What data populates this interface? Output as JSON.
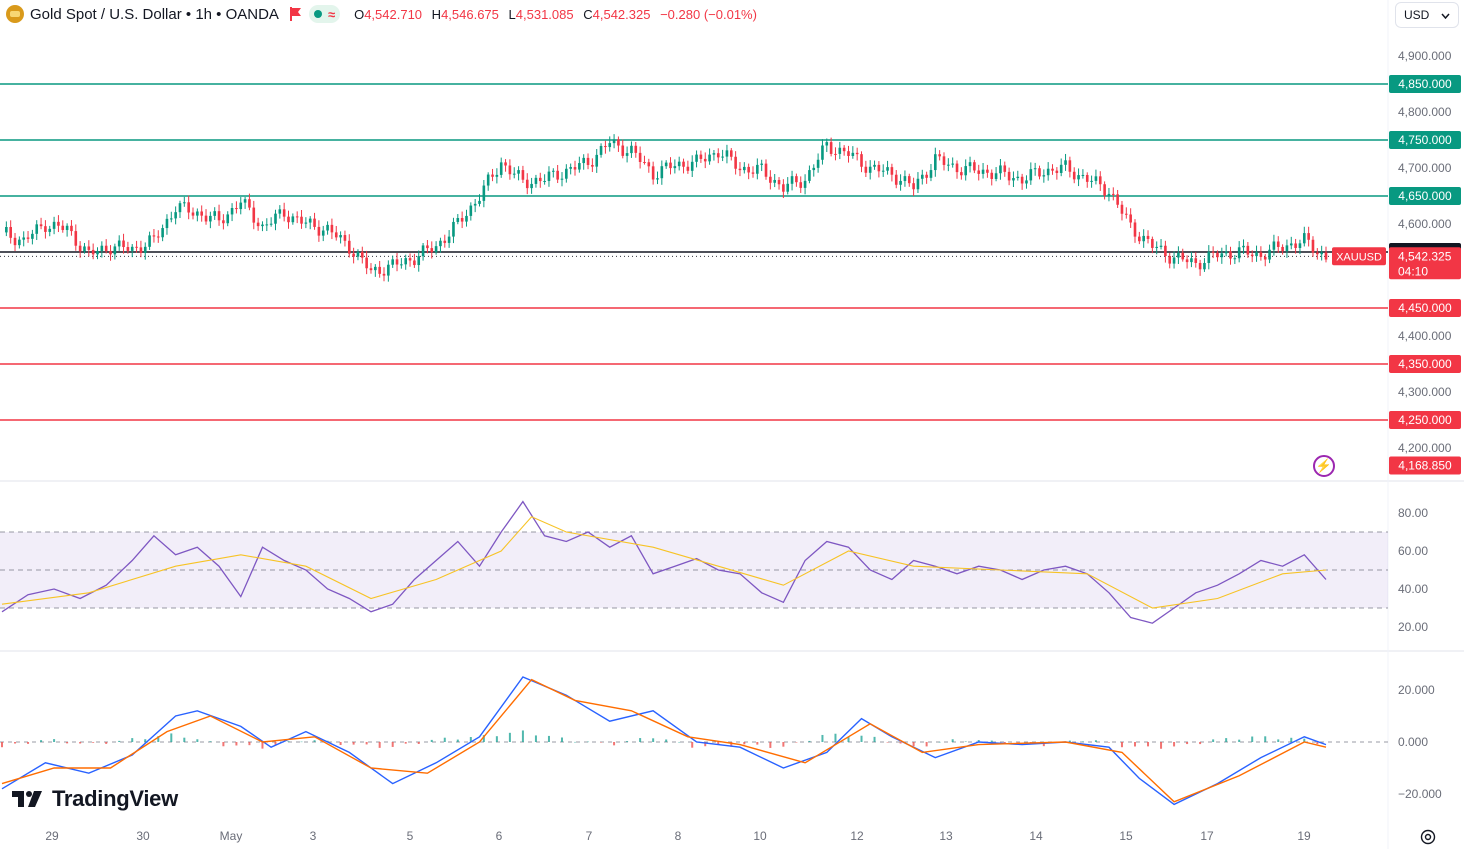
{
  "header": {
    "symbol_title": "Gold Spot / U.S. Dollar • 1h • OANDA",
    "open_label": "O",
    "open": "4,542.710",
    "high_label": "H",
    "high": "4,546.675",
    "low_label": "L",
    "low": "4,531.085",
    "close_label": "C",
    "close": "4,542.325",
    "change": "−0.280 (−0.01%)"
  },
  "currency_select": {
    "value": "USD"
  },
  "branding": {
    "name": "TradingView"
  },
  "icons": {
    "logo": "gold-coin-icon",
    "flag": "flag-icon",
    "market": "market-status-icon",
    "bolt": "lightning-icon",
    "settings": "settings-icon",
    "dropdown": "chevron-down-icon"
  },
  "colors": {
    "up": "#089981",
    "down": "#f23645",
    "support": "#f23645",
    "resistance": "#089981",
    "rsi": "#7e57c2",
    "rsi_ma": "#f7c325",
    "macd": "#2962ff",
    "signal": "#ff6d00"
  },
  "chart_data": [
    {
      "type": "candlestick",
      "title": "Gold Spot / U.S. Dollar • 1h • OANDA",
      "price_axis_ticks": [
        "4,900.000",
        "4,800.000",
        "4,700.000",
        "4,600.000",
        "4,400.000",
        "4,300.000",
        "4,200.000"
      ],
      "ylim": [
        4165,
        4930
      ],
      "time_axis_ticks": [
        "29",
        "30",
        "May",
        "3",
        "5",
        "6",
        "7",
        "8",
        "10",
        "12",
        "13",
        "14",
        "15",
        "17",
        "19"
      ],
      "horizontal_levels": [
        {
          "value": 4850,
          "label": "4,850.000",
          "kind": "resistance"
        },
        {
          "value": 4750,
          "label": "4,750.000",
          "kind": "resistance"
        },
        {
          "value": 4650,
          "label": "4,650.000",
          "kind": "resistance"
        },
        {
          "value": 4550,
          "label": "4,550.000",
          "kind": "pivot"
        },
        {
          "value": 4450,
          "label": "4,450.000",
          "kind": "support"
        },
        {
          "value": 4350,
          "label": "4,350.000",
          "kind": "support"
        },
        {
          "value": 4250,
          "label": "4,250.000",
          "kind": "support"
        }
      ],
      "last_price": {
        "symbol": "XAUUSD",
        "value": "4,542.325",
        "countdown": "04:10"
      },
      "low_marker": "4,168.850",
      "close_path": [
        [
          0,
          4585
        ],
        [
          5,
          4570
        ],
        [
          10,
          4600
        ],
        [
          15,
          4590
        ],
        [
          20,
          4545
        ],
        [
          25,
          4560
        ],
        [
          30,
          4555
        ],
        [
          35,
          4570
        ],
        [
          40,
          4630
        ],
        [
          45,
          4620
        ],
        [
          50,
          4605
        ],
        [
          55,
          4640
        ],
        [
          60,
          4595
        ],
        [
          65,
          4620
        ],
        [
          70,
          4600
        ],
        [
          75,
          4590
        ],
        [
          80,
          4560
        ],
        [
          85,
          4515
        ],
        [
          90,
          4525
        ],
        [
          95,
          4540
        ],
        [
          100,
          4560
        ],
        [
          105,
          4600
        ],
        [
          110,
          4650
        ],
        [
          115,
          4710
        ],
        [
          120,
          4675
        ],
        [
          125,
          4680
        ],
        [
          130,
          4695
        ],
        [
          135,
          4710
        ],
        [
          140,
          4745
        ],
        [
          145,
          4730
        ],
        [
          150,
          4690
        ],
        [
          155,
          4705
        ],
        [
          160,
          4710
        ],
        [
          165,
          4730
        ],
        [
          170,
          4700
        ],
        [
          175,
          4695
        ],
        [
          180,
          4665
        ],
        [
          185,
          4680
        ],
        [
          190,
          4740
        ],
        [
          195,
          4725
        ],
        [
          200,
          4700
        ],
        [
          205,
          4690
        ],
        [
          210,
          4665
        ],
        [
          215,
          4715
        ],
        [
          220,
          4700
        ],
        [
          225,
          4695
        ],
        [
          230,
          4690
        ],
        [
          235,
          4680
        ],
        [
          240,
          4695
        ],
        [
          245,
          4700
        ],
        [
          250,
          4680
        ],
        [
          255,
          4660
        ],
        [
          260,
          4595
        ],
        [
          265,
          4560
        ],
        [
          270,
          4540
        ],
        [
          275,
          4530
        ],
        [
          280,
          4545
        ],
        [
          285,
          4550
        ],
        [
          290,
          4545
        ],
        [
          295,
          4560
        ],
        [
          300,
          4570
        ],
        [
          305,
          4540
        ]
      ]
    },
    {
      "type": "line",
      "title": "RSI",
      "axis_ticks": [
        "80.00",
        "60.00",
        "40.00",
        "20.00"
      ],
      "ylim": [
        15,
        88
      ],
      "band": [
        30,
        70
      ],
      "midline": 50,
      "series": [
        {
          "role": "rsi",
          "points": [
            [
              0,
              28
            ],
            [
              6,
              37
            ],
            [
              12,
              40
            ],
            [
              18,
              35
            ],
            [
              24,
              42
            ],
            [
              30,
              55
            ],
            [
              35,
              68
            ],
            [
              40,
              58
            ],
            [
              45,
              62
            ],
            [
              50,
              52
            ],
            [
              55,
              36
            ],
            [
              60,
              62
            ],
            [
              65,
              55
            ],
            [
              70,
              50
            ],
            [
              75,
              40
            ],
            [
              80,
              35
            ],
            [
              85,
              28
            ],
            [
              90,
              32
            ],
            [
              95,
              45
            ],
            [
              100,
              55
            ],
            [
              105,
              65
            ],
            [
              110,
              52
            ],
            [
              115,
              70
            ],
            [
              120,
              86
            ],
            [
              125,
              68
            ],
            [
              130,
              65
            ],
            [
              135,
              70
            ],
            [
              140,
              62
            ],
            [
              145,
              68
            ],
            [
              150,
              48
            ],
            [
              155,
              52
            ],
            [
              160,
              56
            ],
            [
              165,
              50
            ],
            [
              170,
              48
            ],
            [
              175,
              38
            ],
            [
              180,
              33
            ],
            [
              185,
              55
            ],
            [
              190,
              65
            ],
            [
              195,
              62
            ],
            [
              200,
              50
            ],
            [
              205,
              45
            ],
            [
              210,
              55
            ],
            [
              215,
              52
            ],
            [
              220,
              48
            ],
            [
              225,
              52
            ],
            [
              230,
              50
            ],
            [
              235,
              45
            ],
            [
              240,
              50
            ],
            [
              245,
              52
            ],
            [
              250,
              48
            ],
            [
              255,
              38
            ],
            [
              260,
              25
            ],
            [
              265,
              22
            ],
            [
              270,
              30
            ],
            [
              275,
              38
            ],
            [
              280,
              42
            ],
            [
              285,
              48
            ],
            [
              290,
              55
            ],
            [
              295,
              52
            ],
            [
              300,
              58
            ],
            [
              305,
              45
            ]
          ]
        },
        {
          "role": "rsi-ma",
          "points": [
            [
              0,
              32
            ],
            [
              20,
              38
            ],
            [
              40,
              52
            ],
            [
              55,
              58
            ],
            [
              70,
              52
            ],
            [
              85,
              35
            ],
            [
              100,
              45
            ],
            [
              115,
              60
            ],
            [
              122,
              78
            ],
            [
              130,
              70
            ],
            [
              150,
              62
            ],
            [
              165,
              52
            ],
            [
              180,
              42
            ],
            [
              195,
              60
            ],
            [
              210,
              52
            ],
            [
              230,
              50
            ],
            [
              250,
              48
            ],
            [
              265,
              30
            ],
            [
              280,
              35
            ],
            [
              295,
              48
            ],
            [
              305,
              50
            ]
          ]
        }
      ]
    },
    {
      "type": "line",
      "title": "MACD",
      "axis_ticks": [
        "20.000",
        "0.000",
        "−20.000"
      ],
      "ylim": [
        -26,
        27
      ],
      "zero": 0,
      "series": [
        {
          "role": "macd",
          "points": [
            [
              0,
              -18
            ],
            [
              10,
              -8
            ],
            [
              20,
              -12
            ],
            [
              30,
              -5
            ],
            [
              40,
              10
            ],
            [
              45,
              12
            ],
            [
              55,
              6
            ],
            [
              62,
              -2
            ],
            [
              70,
              4
            ],
            [
              80,
              -4
            ],
            [
              90,
              -16
            ],
            [
              100,
              -8
            ],
            [
              110,
              2
            ],
            [
              120,
              25
            ],
            [
              130,
              18
            ],
            [
              140,
              8
            ],
            [
              150,
              12
            ],
            [
              160,
              0
            ],
            [
              170,
              -2
            ],
            [
              180,
              -10
            ],
            [
              190,
              -4
            ],
            [
              198,
              9
            ],
            [
              205,
              2
            ],
            [
              215,
              -6
            ],
            [
              225,
              0
            ],
            [
              235,
              -1
            ],
            [
              245,
              0
            ],
            [
              255,
              -2
            ],
            [
              262,
              -14
            ],
            [
              270,
              -24
            ],
            [
              280,
              -16
            ],
            [
              290,
              -6
            ],
            [
              300,
              2
            ],
            [
              305,
              -1
            ]
          ]
        },
        {
          "role": "signal",
          "points": [
            [
              0,
              -16
            ],
            [
              12,
              -10
            ],
            [
              25,
              -10
            ],
            [
              38,
              4
            ],
            [
              48,
              10
            ],
            [
              60,
              0
            ],
            [
              72,
              2
            ],
            [
              85,
              -10
            ],
            [
              98,
              -12
            ],
            [
              110,
              0
            ],
            [
              122,
              24
            ],
            [
              132,
              16
            ],
            [
              145,
              12
            ],
            [
              158,
              2
            ],
            [
              170,
              -1
            ],
            [
              185,
              -8
            ],
            [
              200,
              7
            ],
            [
              212,
              -4
            ],
            [
              225,
              -1
            ],
            [
              245,
              0
            ],
            [
              258,
              -4
            ],
            [
              270,
              -23
            ],
            [
              285,
              -13
            ],
            [
              300,
              0
            ],
            [
              305,
              -2
            ]
          ]
        },
        {
          "role": "histogram",
          "points": [
            [
              0,
              -2
            ],
            [
              10,
              1
            ],
            [
              20,
              -1
            ],
            [
              30,
              1
            ],
            [
              40,
              3
            ],
            [
              50,
              -1
            ],
            [
              60,
              -2
            ],
            [
              70,
              1
            ],
            [
              80,
              -1
            ],
            [
              90,
              -2
            ],
            [
              100,
              1
            ],
            [
              110,
              2
            ],
            [
              120,
              4
            ],
            [
              130,
              1
            ],
            [
              140,
              -1
            ],
            [
              150,
              2
            ],
            [
              160,
              -2
            ],
            [
              170,
              -1
            ],
            [
              180,
              -2
            ],
            [
              190,
              3
            ],
            [
              200,
              2
            ],
            [
              210,
              -2
            ],
            [
              220,
              1
            ],
            [
              230,
              0
            ],
            [
              240,
              -1
            ],
            [
              250,
              1
            ],
            [
              260,
              -2
            ],
            [
              270,
              -2
            ],
            [
              280,
              1
            ],
            [
              290,
              2
            ],
            [
              300,
              1
            ],
            [
              305,
              -1
            ]
          ]
        }
      ]
    }
  ]
}
